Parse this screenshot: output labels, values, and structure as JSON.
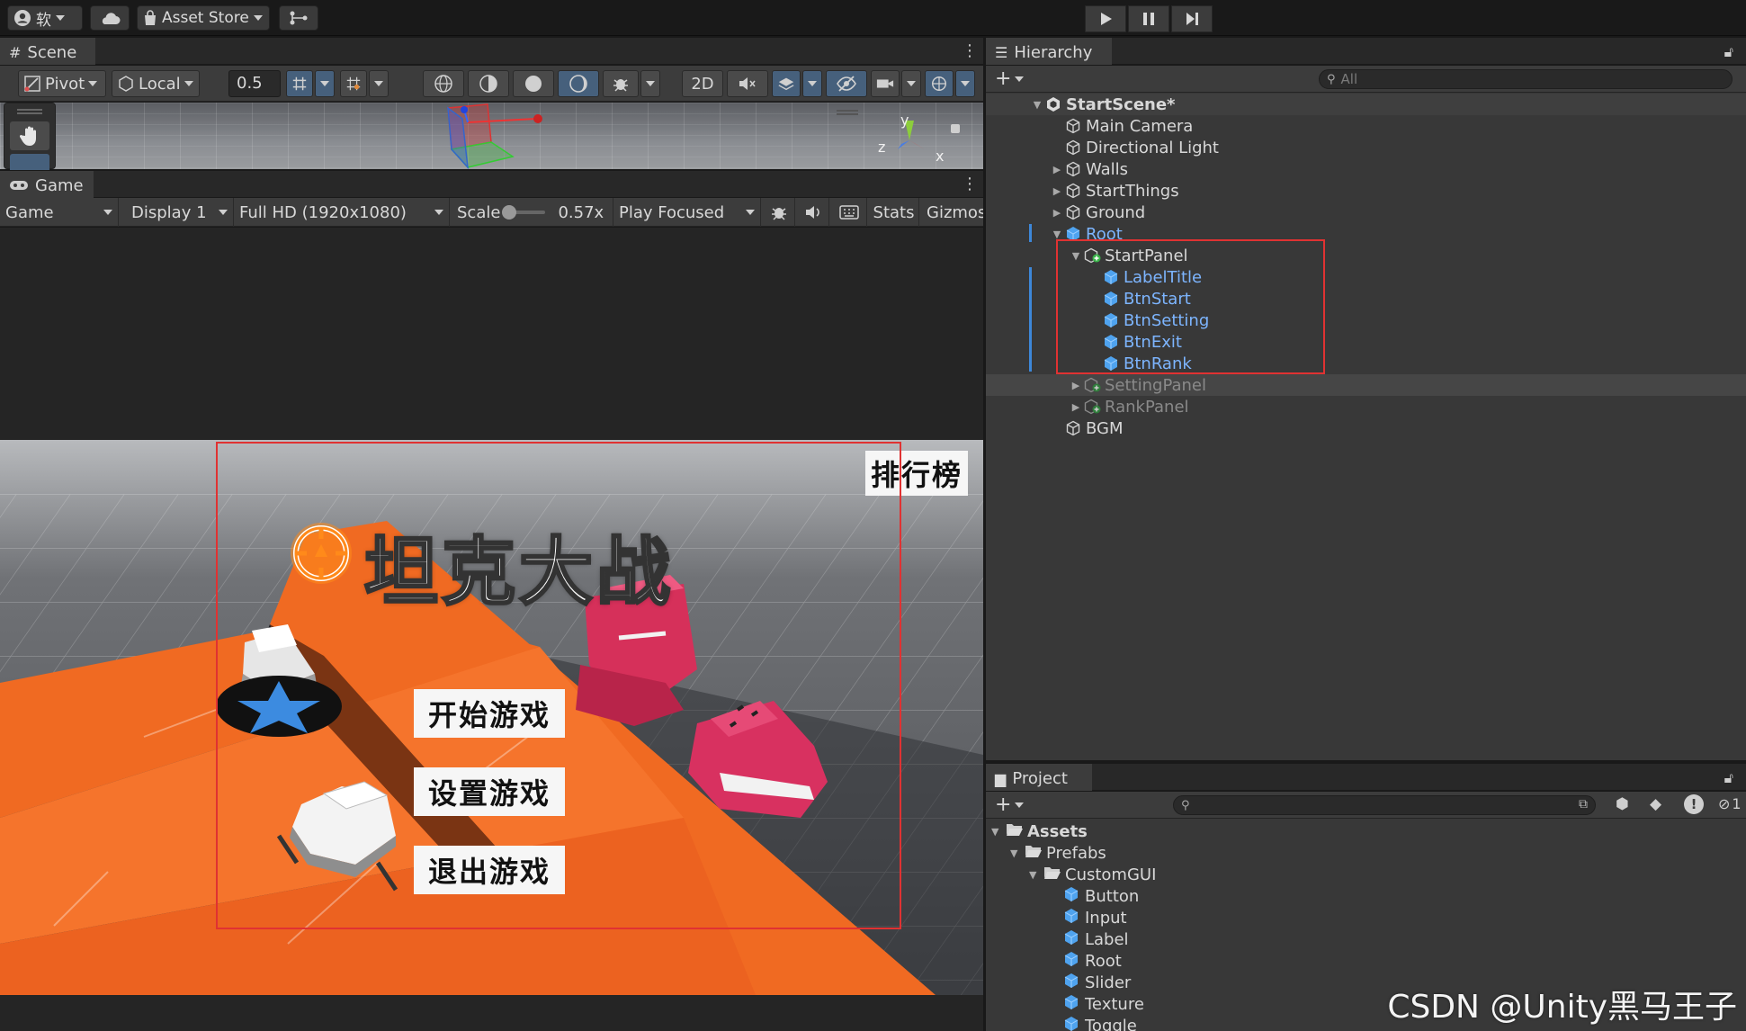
{
  "topbar": {
    "account_label": "软",
    "asset_store": "Asset Store"
  },
  "scene": {
    "tab": "Scene",
    "pivot": "Pivot",
    "local": "Local",
    "grid_size": "0.5",
    "mode_2d": "2D",
    "gizmo_y": "y",
    "gizmo_z": "z",
    "gizmo_x": "x"
  },
  "game": {
    "tab": "Game",
    "view_mode": "Game",
    "display": "Display 1",
    "resolution": "Full HD (1920x1080)",
    "scale_label": "Scale",
    "scale_value": "0.57x",
    "play_mode": "Play Focused",
    "stats": "Stats",
    "gizmos": "Gizmos",
    "ui": {
      "title": "坦克大战",
      "rank": "排行榜",
      "start": "开始游戏",
      "setting": "设置游戏",
      "exit": "退出游戏"
    }
  },
  "hierarchy": {
    "tab": "Hierarchy",
    "search_placeholder": "All",
    "scene_name": "StartScene*",
    "items": [
      {
        "label": "Main Camera"
      },
      {
        "label": "Directional Light"
      },
      {
        "label": "Walls"
      },
      {
        "label": "StartThings"
      },
      {
        "label": "Ground"
      },
      {
        "label": "Root"
      },
      {
        "label": "StartPanel"
      },
      {
        "label": "LabelTitle"
      },
      {
        "label": "BtnStart"
      },
      {
        "label": "BtnSetting"
      },
      {
        "label": "BtnExit"
      },
      {
        "label": "BtnRank"
      },
      {
        "label": "SettingPanel"
      },
      {
        "label": "RankPanel"
      },
      {
        "label": "BGM"
      }
    ]
  },
  "project": {
    "tab": "Project",
    "hidden_count": "1",
    "tree": [
      {
        "label": "Assets"
      },
      {
        "label": "Prefabs"
      },
      {
        "label": "CustomGUI"
      },
      {
        "label": "Button"
      },
      {
        "label": "Input"
      },
      {
        "label": "Label"
      },
      {
        "label": "Root"
      },
      {
        "label": "Slider"
      },
      {
        "label": "Texture"
      },
      {
        "label": "Toggle"
      }
    ]
  },
  "watermark": "CSDN @Unity黑马王子",
  "colors": {
    "highlight_box": "#e03232",
    "prefab_blue": "#7db5ff",
    "ground_orange": "#f0661e",
    "tank_red": "#d9315a"
  }
}
